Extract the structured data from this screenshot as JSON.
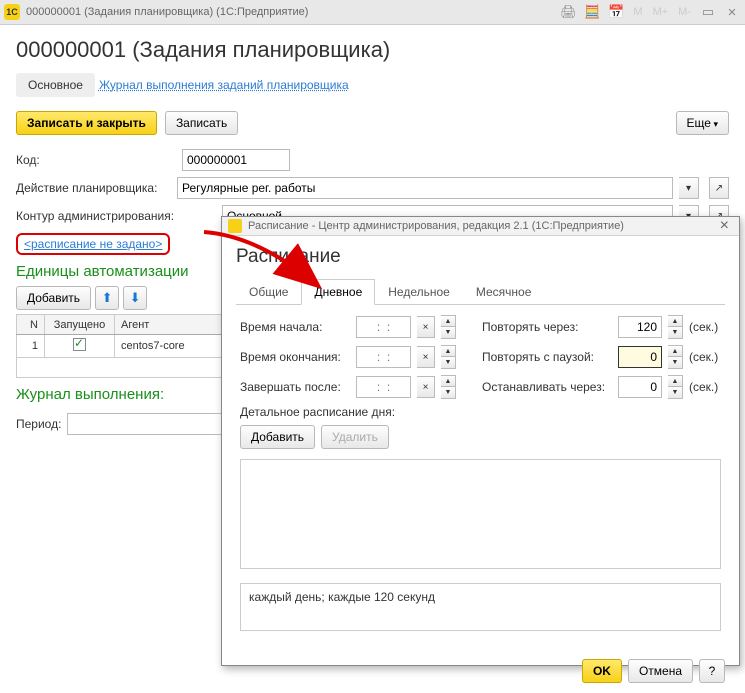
{
  "window": {
    "title": "000000001 (Задания планировщика)  (1С:Предприятие)",
    "logo_text": "1С"
  },
  "page": {
    "heading": "000000001 (Задания планировщика)"
  },
  "nav": {
    "main_tab": "Основное",
    "journal_link": "Журнал выполнения заданий планировщика"
  },
  "toolbar": {
    "save_close": "Записать и закрыть",
    "save": "Записать",
    "more": "Еще"
  },
  "fields": {
    "code_label": "Код:",
    "code_value": "000000001",
    "action_label": "Действие планировщика:",
    "action_value": "Регулярные рег. работы",
    "kontur_label": "Контур администрирования:",
    "kontur_value": "Основной",
    "schedule_link": "<расписание не задано>"
  },
  "units": {
    "title": "Единицы автоматизации",
    "add_btn": "Добавить",
    "columns": {
      "n": "N",
      "launched": "Запущено",
      "agent": "Агент"
    },
    "rows": [
      {
        "n": "1",
        "launched": true,
        "agent": "centos7-core"
      }
    ]
  },
  "journal": {
    "title": "Журнал выполнения:",
    "period_label": "Период:",
    "period_value": "",
    "period_placeholder": "..."
  },
  "dialog": {
    "title": "Расписание - Центр администрирования, редакция 2.1  (1С:Предприятие)",
    "heading": "Расписание",
    "tabs": {
      "general": "Общие",
      "daily": "Дневное",
      "weekly": "Недельное",
      "monthly": "Месячное"
    },
    "daily": {
      "start_label": "Время начала:",
      "end_label": "Время окончания:",
      "finish_after_label": "Завершать после:",
      "time_placeholder": "  :  :  ",
      "repeat_interval_label": "Повторять через:",
      "repeat_interval_value": "120",
      "repeat_pause_label": "Повторять с паузой:",
      "repeat_pause_value": "0",
      "stop_after_label": "Останавливать через:",
      "stop_after_value": "0",
      "sek": "(сек.)",
      "detail_title": "Детальное расписание дня:",
      "add": "Добавить",
      "delete": "Удалить"
    },
    "summary": "каждый день; каждые 120 секунд",
    "ok": "OK",
    "cancel": "Отмена",
    "help": "?"
  }
}
